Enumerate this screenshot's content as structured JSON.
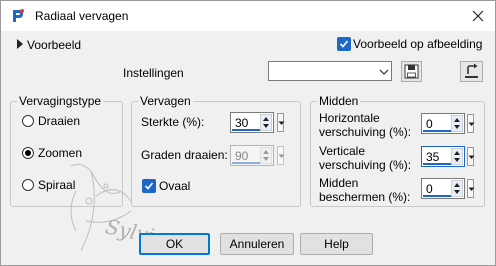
{
  "title": "Radiaal vervagen",
  "preview": {
    "label": "Voorbeeld"
  },
  "preview_on_image": {
    "label": "Voorbeeld op afbeelding",
    "checked": true
  },
  "settings": {
    "label": "Instellingen",
    "value": ""
  },
  "vervagingstype": {
    "legend": "Vervagingstype",
    "options": [
      {
        "label": "Draaien",
        "selected": false
      },
      {
        "label": "Zoomen",
        "selected": true
      },
      {
        "label": "Spiraal",
        "selected": false
      }
    ]
  },
  "vervagen": {
    "legend": "Vervagen",
    "sterkte_label": "Sterkte (%):",
    "sterkte_value": "30",
    "graden_label": "Graden draaien:",
    "graden_value": "90",
    "ovaal_label": "Ovaal",
    "ovaal_checked": true
  },
  "midden": {
    "legend": "Midden",
    "hor_line1": "Horizontale",
    "hor_line2": "verschuiving (%):",
    "hor_value": "0",
    "vert_line1": "Verticale",
    "vert_line2": "verschuiving (%):",
    "vert_value": "35",
    "prot_line1": "Midden",
    "prot_line2": "beschermen (%):",
    "prot_value": "0"
  },
  "buttons": {
    "ok": "OK",
    "cancel": "Annuleren",
    "help": "Help"
  },
  "watermark_text": "Sylviane",
  "colors": {
    "accent": "#1e67c8",
    "default_button_border": "#0078d7"
  }
}
